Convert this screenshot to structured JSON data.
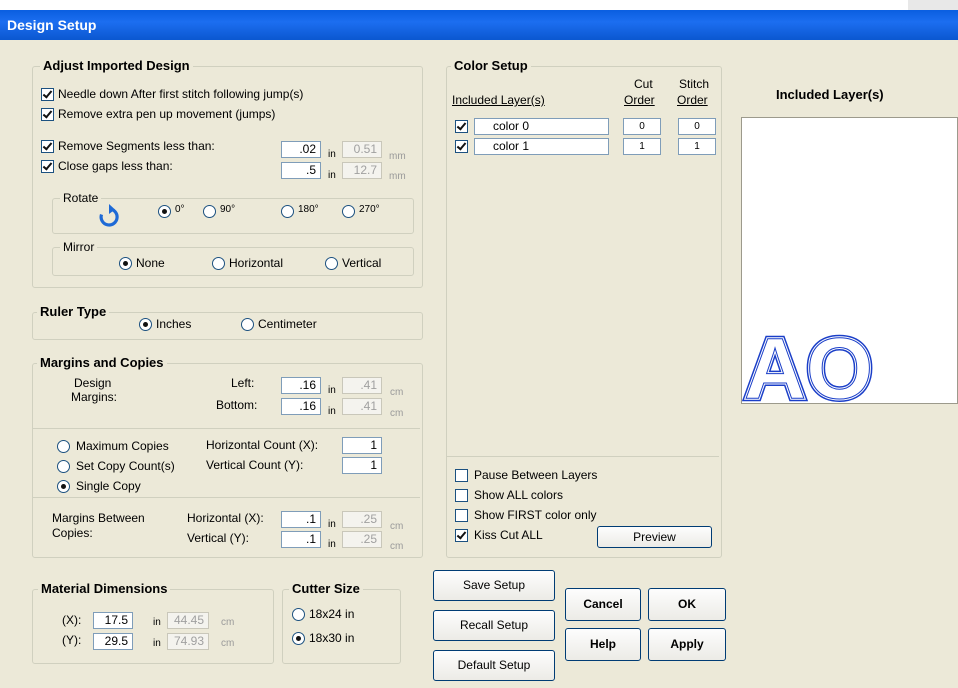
{
  "window": {
    "title": "Design Setup"
  },
  "adjust": {
    "legend": "Adjust Imported Design",
    "needle_down": "Needle down After first stitch following jump(s)",
    "remove_pen_up": "Remove extra pen up movement (jumps)",
    "remove_segments": "Remove Segments less than:",
    "remove_segments_in": ".02",
    "remove_segments_mm": "0.51",
    "close_gaps": "Close gaps less than:",
    "close_gaps_in": ".5",
    "close_gaps_mm": "12.7",
    "unit_in": "in",
    "unit_mm": "mm",
    "rotate": {
      "legend": "Rotate",
      "options": [
        "0°",
        "90°",
        "180°",
        "270°"
      ],
      "selected": "0°",
      "icon": "rotate-clockwise-icon"
    },
    "mirror": {
      "legend": "Mirror",
      "options": [
        "None",
        "Horizontal",
        "Vertical"
      ],
      "selected": "None"
    }
  },
  "ruler": {
    "legend": "Ruler Type",
    "options": [
      "Inches",
      "Centimeter"
    ],
    "selected": "Inches"
  },
  "margins": {
    "legend": "Margins and Copies",
    "design_margins": "Design\nMargins:",
    "design_line1": "Design",
    "design_line2": "Margins:",
    "left_label": "Left:",
    "left_in": ".16",
    "left_cm": ".41",
    "bottom_label": "Bottom:",
    "bottom_in": ".16",
    "bottom_cm": ".41",
    "unit_in": "in",
    "unit_cm": "cm",
    "copies_options": [
      "Maximum Copies",
      "Set Copy Count(s)",
      "Single Copy"
    ],
    "copies_selected": "Single Copy",
    "hcount_label": "Horizontal Count (X):",
    "hcount": "1",
    "vcount_label": "Vertical Count (Y):",
    "vcount": "1",
    "between_line1": "Margins Between",
    "between_line2": "Copies:",
    "h_label": "Horizontal (X):",
    "h_in": ".1",
    "h_cm": ".25",
    "v_label": "Vertical (Y):",
    "v_in": ".1",
    "v_cm": ".25"
  },
  "material": {
    "legend": "Material Dimensions",
    "x_label": "(X):",
    "x_in": "17.5",
    "x_cm": "44.45",
    "y_label": "(Y):",
    "y_in": "29.5",
    "y_cm": "74.93",
    "unit_in": "in",
    "unit_cm": "cm"
  },
  "cutter": {
    "legend": "Cutter Size",
    "options": [
      "18x24 in",
      "18x30 in"
    ],
    "selected": "18x30 in"
  },
  "color": {
    "legend": "Color Setup",
    "col_layers": "Included Layer(s)",
    "col_cut_1": "Cut",
    "col_cut_2": "Order",
    "col_stitch_1": "Stitch",
    "col_stitch_2": "Order",
    "layers": [
      {
        "name": "color 0",
        "cut": "0",
        "stitch": "0",
        "checked": true
      },
      {
        "name": "color 1",
        "cut": "1",
        "stitch": "1",
        "checked": true
      }
    ],
    "pause": "Pause Between Layers",
    "show_all": "Show ALL colors",
    "show_first": "Show FIRST color only",
    "kiss_cut": "Kiss Cut ALL",
    "preview_btn": "Preview"
  },
  "preview_panel": {
    "title": "Included Layer(s)",
    "glyphs": "AO",
    "stroke_color": "#1a3ec8"
  },
  "buttons": {
    "save": "Save Setup",
    "recall": "Recall Setup",
    "default": "Default Setup",
    "cancel": "Cancel",
    "ok": "OK",
    "help": "Help",
    "apply": "Apply"
  }
}
